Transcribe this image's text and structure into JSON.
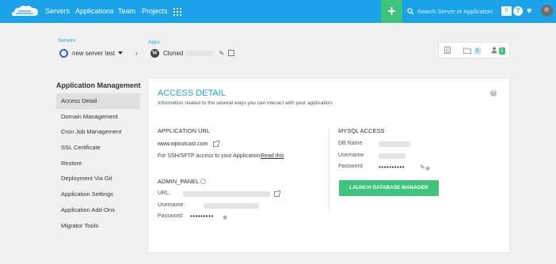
{
  "topbar": {
    "nav": [
      "Servers",
      "Applications",
      "Team",
      "Projects"
    ],
    "search_placeholder": "Search Server or Application",
    "notification_count": "0",
    "help_label": "?",
    "plus_label": "+",
    "heart_label": "♥"
  },
  "breadcrumb": {
    "servers_label": "Servers",
    "server_name": "new server test",
    "apps_label": "Apps",
    "app_name": "Cloned",
    "arrow": "›"
  },
  "quick_actions": {
    "folder_count": "0",
    "users_count": "1"
  },
  "sidebar": {
    "title": "Application Management",
    "items": [
      {
        "label": "Access Detail",
        "active": true
      },
      {
        "label": "Domain Management",
        "active": false
      },
      {
        "label": "Cron Job Management",
        "active": false
      },
      {
        "label": "SSL Certificate",
        "active": false
      },
      {
        "label": "Restore",
        "active": false
      },
      {
        "label": "Deployment Via Git",
        "active": false
      },
      {
        "label": "Application Settings",
        "active": false
      },
      {
        "label": "Application Add-Ons",
        "active": false
      },
      {
        "label": "Migrator Tools",
        "active": false
      }
    ]
  },
  "access_detail": {
    "title": "ACCESS DETAIL",
    "subtitle": "Information related to the several ways you can interact with your application.",
    "application_url": {
      "heading": "APPLICATION URL",
      "url": "www.wpoutcast.com",
      "ssh_note": "For SSH/SFTP access to your Application.",
      "read_this": "Read this"
    },
    "admin_panel": {
      "heading": "ADMIN_PANEL",
      "url_label": "URL:",
      "username_label": "Username:",
      "password_label": "Password:",
      "password_mask": "•••••••••"
    },
    "mysql_access": {
      "heading": "MYSQL ACCESS",
      "db_name_label": "DB Name",
      "username_label": "Username",
      "password_label": "Password",
      "password_mask": "••••••••••",
      "launch_button": "LAUNCH DATABASE MANAGER"
    },
    "help_icon": "?"
  }
}
